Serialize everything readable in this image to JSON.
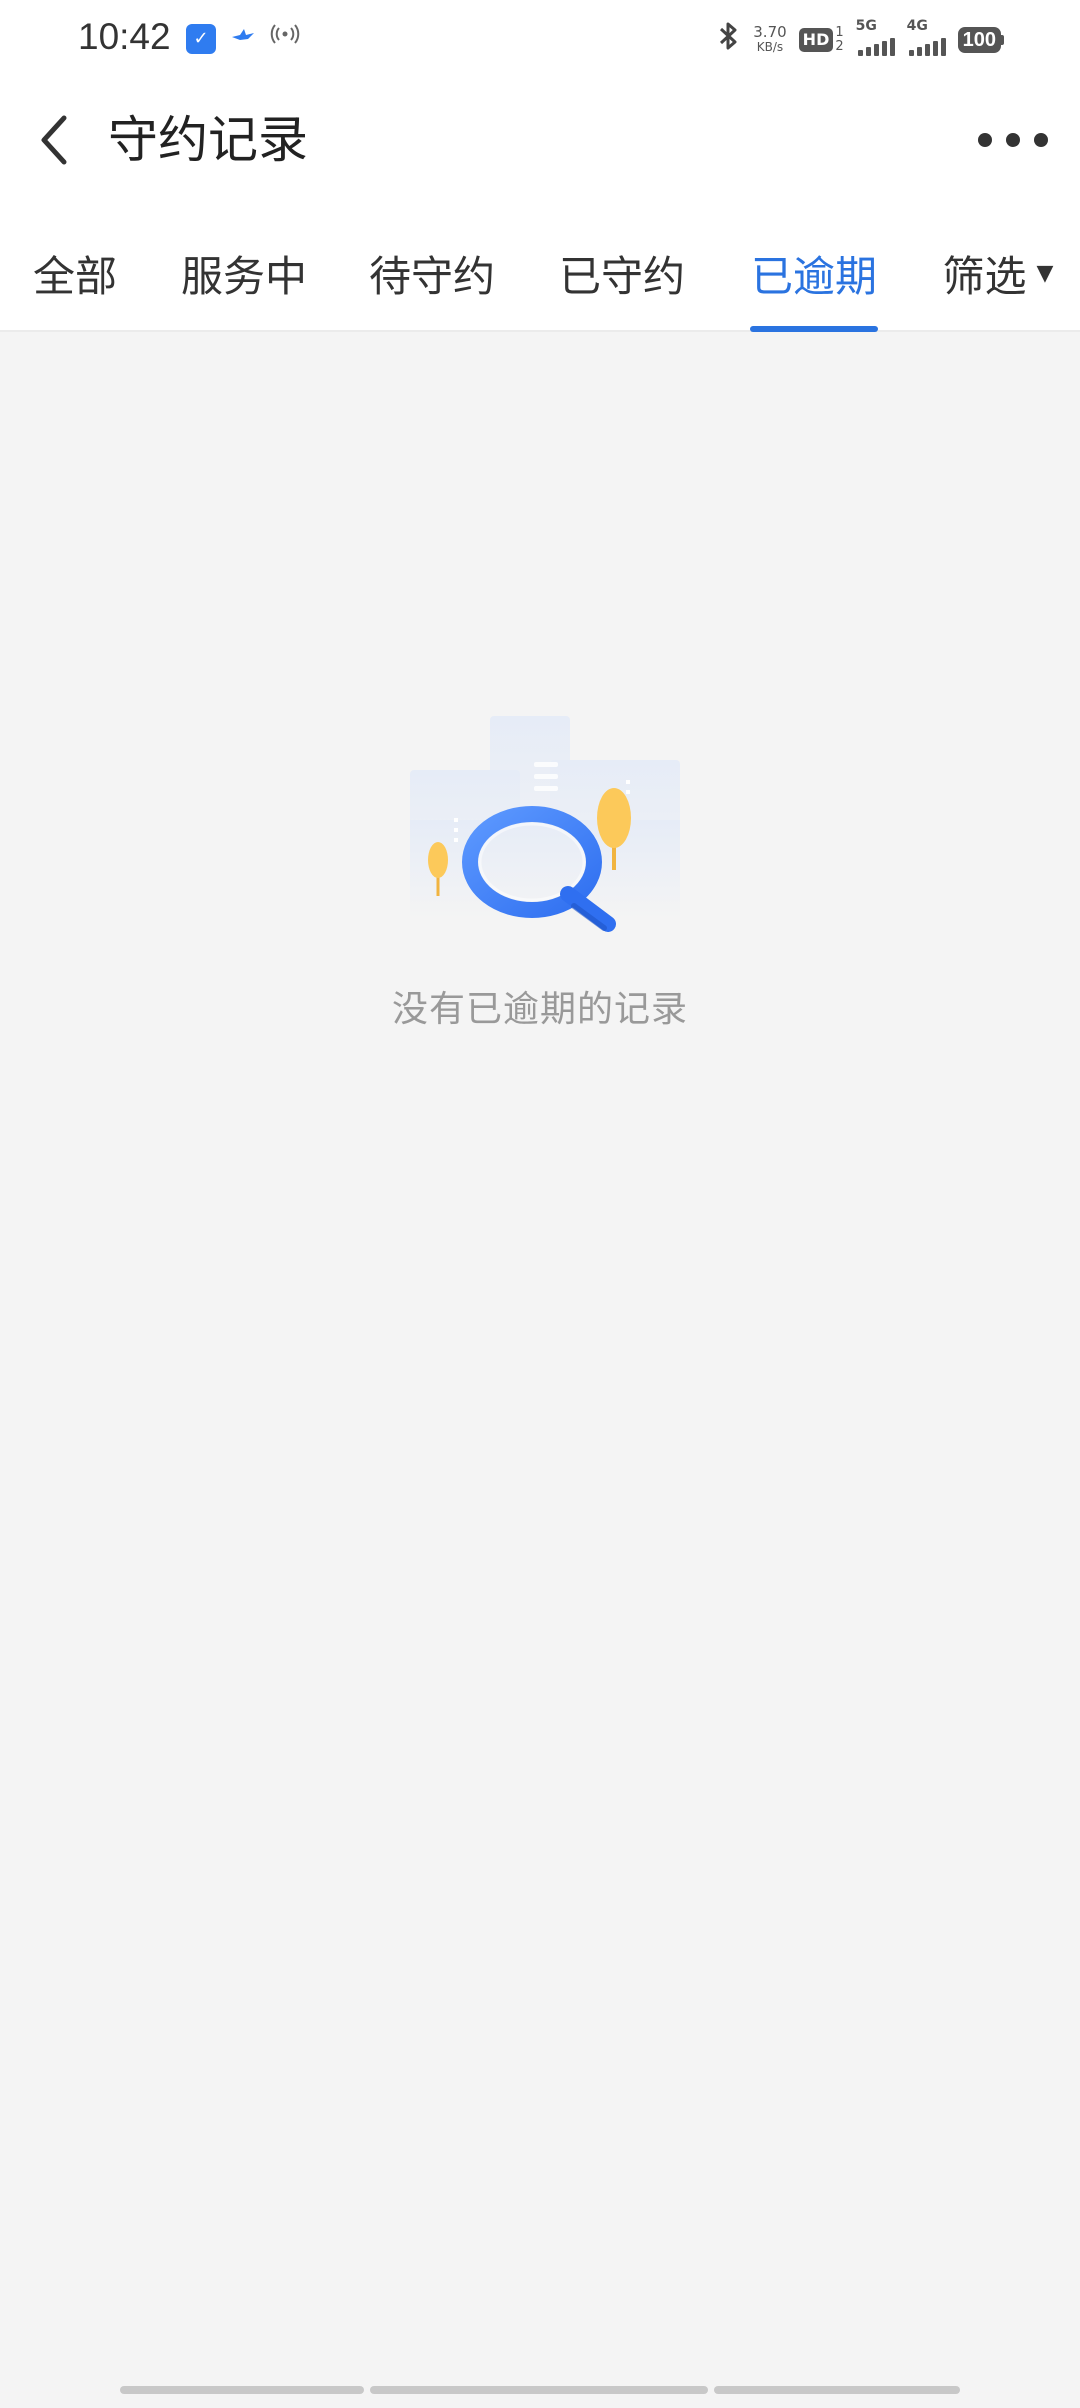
{
  "status_bar": {
    "time": "10:42",
    "net_speed_value": "3.70",
    "net_speed_unit": "KB/s",
    "hd_label": "HD",
    "hd_sub_top": "1",
    "hd_sub_bottom": "2",
    "signal_1_tag": "5G",
    "signal_2_tag": "4G",
    "battery": "100",
    "icons": [
      "app-notification-icon",
      "bird-app-icon",
      "hotspot-icon",
      "bluetooth-icon",
      "signal-5g-icon",
      "signal-4g-icon",
      "battery-icon"
    ]
  },
  "header": {
    "title": "守约记录",
    "back_icon": "chevron-left-icon",
    "more_icon": "more-dots-icon"
  },
  "tabs": [
    {
      "label": "全部",
      "active": false
    },
    {
      "label": "服务中",
      "active": false
    },
    {
      "label": "待守约",
      "active": false
    },
    {
      "label": "已守约",
      "active": false
    },
    {
      "label": "已逾期",
      "active": true
    },
    {
      "label": "筛选",
      "active": false,
      "has_dropdown": true
    }
  ],
  "empty_state": {
    "message": "没有已逾期的记录",
    "illustration": "magnifier-empty-illustration"
  },
  "colors": {
    "accent": "#2a73e0",
    "background": "#f4f4f4",
    "empty_text": "#999999"
  }
}
